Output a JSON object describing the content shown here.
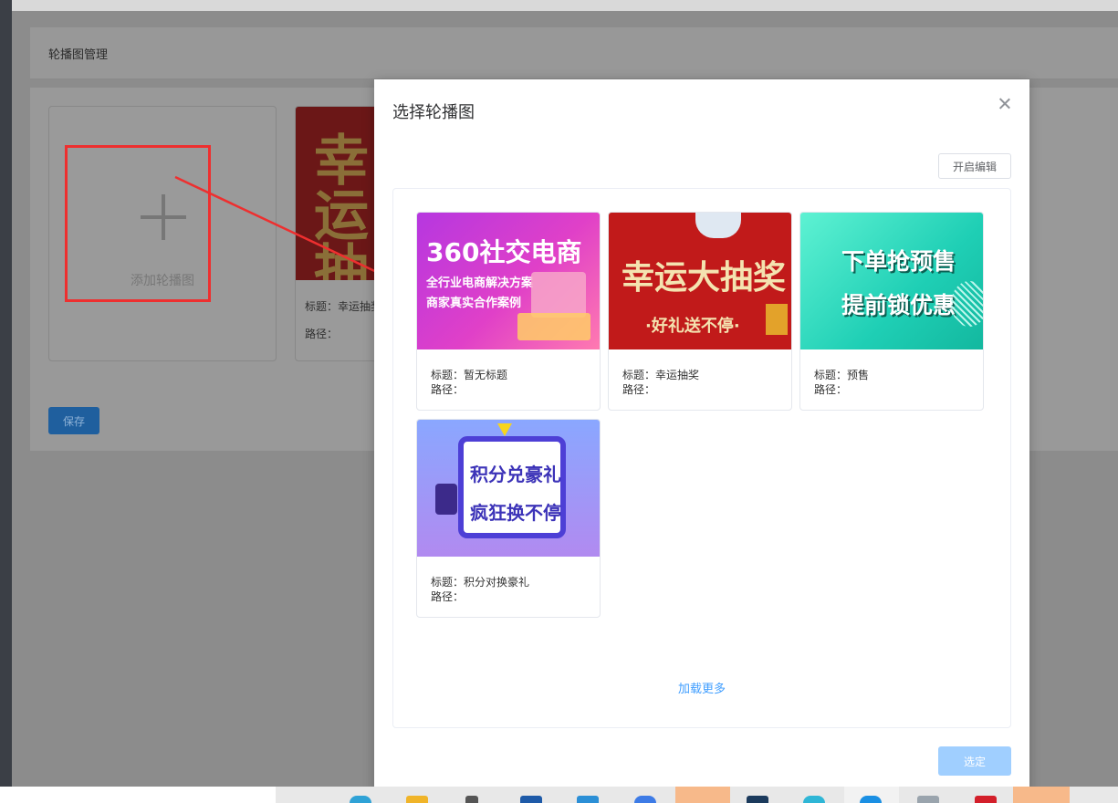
{
  "page": {
    "title": "轮播图管理",
    "add_label": "添加轮播图",
    "existing_card": {
      "title_label": "标题：",
      "title_value": "幸运抽奖",
      "path_label": "路径："
    },
    "save_label": "保存"
  },
  "dialog": {
    "title": "选择轮播图",
    "edit_label": "开启编辑",
    "load_more": "加载更多",
    "confirm_label": "选定",
    "images": [
      {
        "title_label": "标题：",
        "title": "暂无标题",
        "path_label": "路径：",
        "banner_line1": "360社交电商",
        "banner_line2": "全行业电商解决方案",
        "banner_line3": "商家真实合作案例"
      },
      {
        "title_label": "标题：",
        "title": "幸运抽奖",
        "path_label": "路径：",
        "banner_line1": "幸运大抽奖",
        "banner_line2": "·好礼送不停·"
      },
      {
        "title_label": "标题：",
        "title": "预售",
        "path_label": "路径：",
        "banner_line1": "下单抢预售",
        "banner_line2": "提前锁优惠"
      },
      {
        "title_label": "标题：",
        "title": "积分对换豪礼",
        "path_label": "路径：",
        "banner_line1": "积分兑豪礼",
        "banner_line2": "疯狂换不停"
      }
    ]
  },
  "colors": {
    "primary": "#409eff",
    "annotation_red": "#ee2f2f"
  }
}
